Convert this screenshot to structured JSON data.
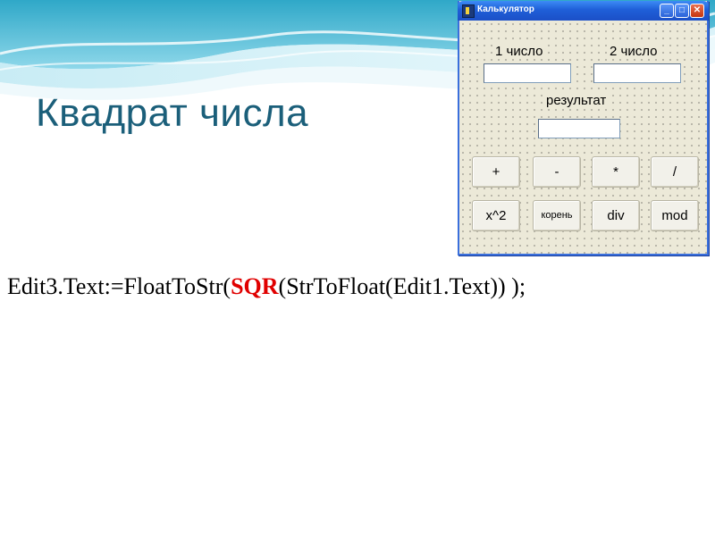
{
  "slide": {
    "title": "Квадрат числа",
    "code": {
      "prefix": "Edit3.Text:=FloatToStr(",
      "keyword": "SQR",
      "suffix": "(StrToFloat(Edit1.Text)) );",
      "keyword_color": "#e00000"
    },
    "title_color": "#1b5f7a"
  },
  "window": {
    "title": "Калькулятор",
    "controls": {
      "minimize": "_",
      "maximize": "□",
      "close": "✕"
    },
    "label1": "1 число",
    "label2": "2 число",
    "label_result": "результат",
    "edit1_value": "",
    "edit2_value": "",
    "edit3_value": "",
    "buttons": [
      "+",
      "-",
      "*",
      "/",
      "x^2",
      "корень",
      "div",
      "mod"
    ]
  }
}
